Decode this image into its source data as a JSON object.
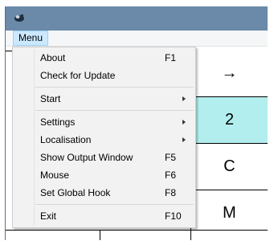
{
  "menubar": {
    "menu_label": "Menu"
  },
  "menu": {
    "items": [
      {
        "label": "About",
        "shortcut": "F1"
      },
      {
        "label": "Check for Update",
        "shortcut": ""
      },
      {
        "label": "Start",
        "shortcut": "",
        "submenu": true
      },
      {
        "label": "Settings",
        "shortcut": "",
        "submenu": true
      },
      {
        "label": "Localisation",
        "shortcut": "",
        "submenu": true
      },
      {
        "label": "Show Output Window",
        "shortcut": "F5"
      },
      {
        "label": "Mouse",
        "shortcut": "F6"
      },
      {
        "label": "Set Global Hook",
        "shortcut": "F8"
      },
      {
        "label": "Exit",
        "shortcut": "F10"
      }
    ]
  },
  "keys": [
    {
      "label": "→",
      "highlighted": false
    },
    {
      "label": "2",
      "highlighted": true
    },
    {
      "label": "C",
      "highlighted": false
    },
    {
      "label": "M",
      "highlighted": false
    }
  ],
  "colors": {
    "titlebar": "#6b89a9",
    "menu_highlight": "#cce8ff",
    "key_highlight": "#b2eeee"
  }
}
